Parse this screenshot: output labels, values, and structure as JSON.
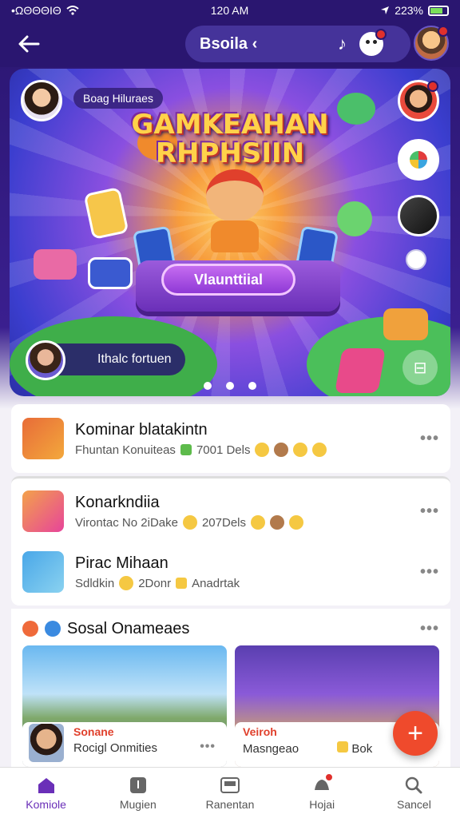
{
  "status_bar": {
    "carrier": "•ΩΘΘΘIΘ",
    "time": "120 AM",
    "battery": "223%"
  },
  "top_bar": {
    "title": "Bsoila ‹",
    "note_glyph": "♪"
  },
  "banner": {
    "host_chip": "Boag Hiluraes",
    "title_line1": "GAMKEAHAN",
    "title_line2": "RHPHSIIN",
    "stage_button": "Vlaunttiial",
    "live_chip": "Ithalc fortuen",
    "expand_glyph": "⊟",
    "active_dot": 0,
    "dot_count": 3
  },
  "feed": {
    "items": [
      {
        "title": "Kominar blatakintn",
        "sub_a": "Fhuntan Konuiteas",
        "sub_b": "7001 Dels"
      },
      {
        "title": "Konarkndiia",
        "sub_a": "Virontac No 2iDake",
        "sub_b": "207Dels"
      },
      {
        "title": "Pirac Mihaan",
        "sub_a": "Sdldkin",
        "sub_b": "2Donr",
        "sub_c": "Anadrtak"
      }
    ],
    "more_glyph": "•••"
  },
  "social": {
    "title": "Sosal Onameaes",
    "tiles": [
      {
        "tag": "Sonane",
        "sub": "Rocigl Onmities"
      },
      {
        "tag": "Veiroh",
        "sub": "Masngeao",
        "count": "Bok"
      }
    ],
    "fab_glyph": "+"
  },
  "nav": {
    "items": [
      {
        "label": "Komiole"
      },
      {
        "label": "Mugien"
      },
      {
        "label": "Ranentan"
      },
      {
        "label": "Hojai"
      },
      {
        "label": "Sancel"
      }
    ],
    "active_index": 0
  },
  "colors": {
    "accent": "#6a2fb8",
    "header": "#2a1670",
    "fab": "#ef4a2c",
    "badge": "#e0302c"
  },
  "icons": [
    "back-arrow-icon",
    "music-note-icon",
    "face-icon",
    "wifi-icon",
    "location-arrow-icon",
    "more-icon",
    "expand-icon",
    "plus-icon",
    "home-icon",
    "music-icon",
    "gallery-icon",
    "bell-icon",
    "search-icon"
  ]
}
